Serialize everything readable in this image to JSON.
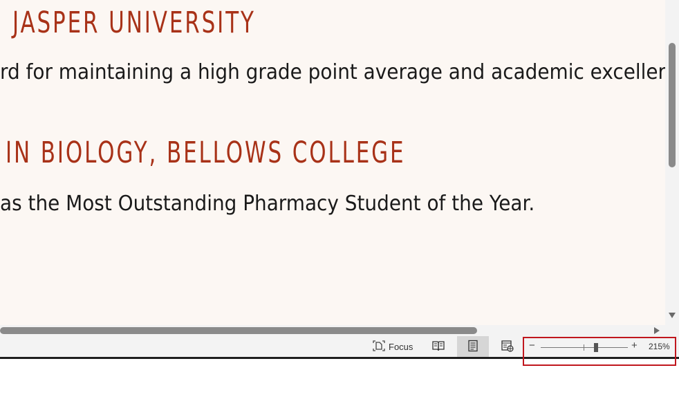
{
  "document": {
    "heading1": "JASPER UNIVERSITY",
    "paragraph1": "rd for maintaining a high grade point average and academic exceller",
    "heading2": "IN BIOLOGY, BELLOWS COLLEGE",
    "paragraph2": "as the Most Outstanding Pharmacy Student of the Year."
  },
  "statusbar": {
    "focus_label": "Focus",
    "views": [
      {
        "name": "read-mode",
        "icon": "book-icon"
      },
      {
        "name": "print-layout",
        "icon": "page-icon",
        "active": true
      },
      {
        "name": "web-layout",
        "icon": "web-page-icon"
      }
    ],
    "zoom": {
      "minus": "−",
      "plus": "+",
      "value_label": "215%"
    }
  },
  "colors": {
    "heading": "#a83218",
    "page_background": "#fcf7f3",
    "highlight": "#c0161d"
  }
}
